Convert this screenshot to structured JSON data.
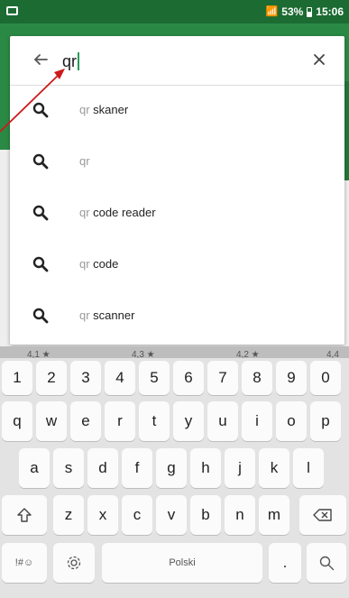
{
  "status_bar": {
    "battery": "53%",
    "time": "15:06"
  },
  "search": {
    "query": "qr",
    "back_icon": "arrow-left-icon",
    "clear_icon": "close-icon"
  },
  "suggestions": [
    {
      "prefix": "qr",
      "rest": " skaner"
    },
    {
      "prefix": "qr",
      "rest": ""
    },
    {
      "prefix": "qr",
      "rest": " code reader"
    },
    {
      "prefix": "qr",
      "rest": " code"
    },
    {
      "prefix": "qr",
      "rest": " scanner"
    }
  ],
  "ratings": [
    "4,1 ★",
    "4,3 ★",
    "4,2 ★",
    "4,4 ★"
  ],
  "keyboard": {
    "numbers": [
      "1",
      "2",
      "3",
      "4",
      "5",
      "6",
      "7",
      "8",
      "9",
      "0"
    ],
    "row1": [
      "q",
      "w",
      "e",
      "r",
      "t",
      "y",
      "u",
      "i",
      "o",
      "p"
    ],
    "row2": [
      "a",
      "s",
      "d",
      "f",
      "g",
      "h",
      "j",
      "k",
      "l"
    ],
    "row3": [
      "z",
      "x",
      "c",
      "v",
      "b",
      "n",
      "m"
    ],
    "symbols_label": "!#☺",
    "space_label": "Polski",
    "period_label": "."
  },
  "colors": {
    "brand_green": "#1f7a3a",
    "annotation_red": "#cc1a1a"
  }
}
